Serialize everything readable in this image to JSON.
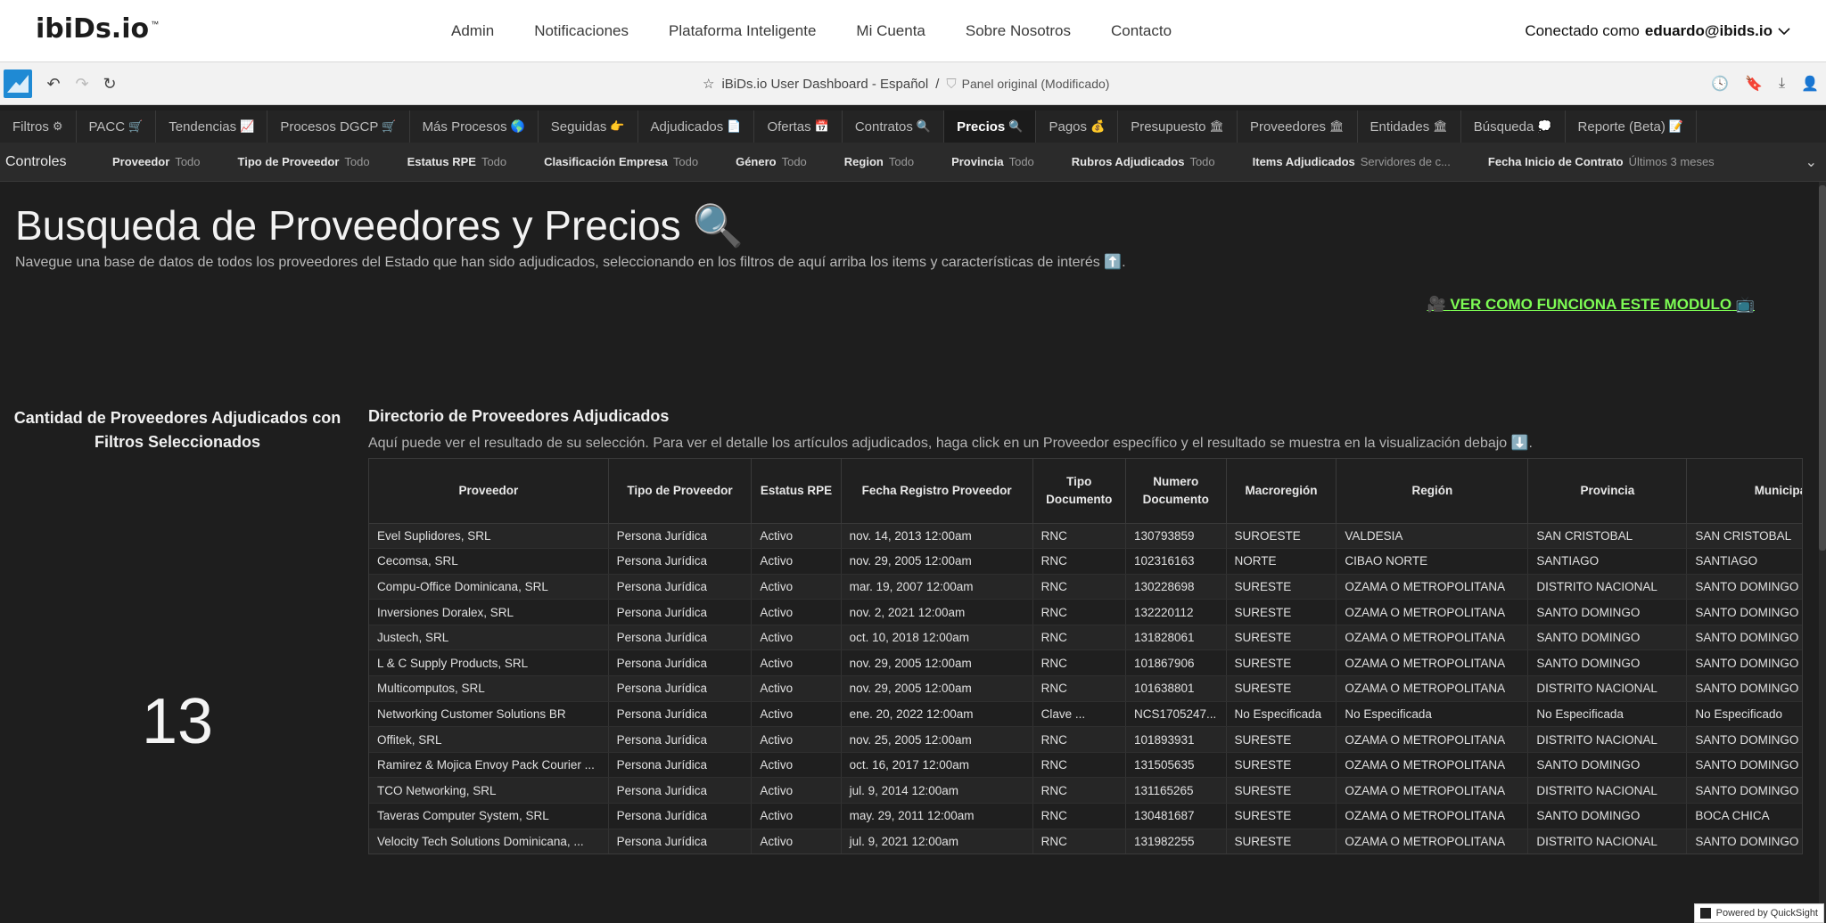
{
  "site": {
    "logo_text": "ibiDs.io",
    "nav": [
      "Admin",
      "Notificaciones",
      "Plataforma Inteligente",
      "Mi Cuenta",
      "Sobre Nosotros",
      "Contacto"
    ],
    "user_prefix": "Conectado como",
    "user_email": "eduardo@ibids.io"
  },
  "toolbar": {
    "dashboard_title": "iBiDs.io User Dashboard - Español",
    "separator": "/",
    "sheet_name": "Panel original (Modificado)"
  },
  "tabs": [
    {
      "label": "Filtros",
      "icon": "⚙"
    },
    {
      "label": "PACC",
      "icon": "🛒"
    },
    {
      "label": "Tendencias",
      "icon": "📈"
    },
    {
      "label": "Procesos DGCP",
      "icon": "🛒"
    },
    {
      "label": "Más Procesos",
      "icon": "🌎"
    },
    {
      "label": "Seguidas",
      "icon": "👉"
    },
    {
      "label": "Adjudicados",
      "icon": "📄"
    },
    {
      "label": "Ofertas",
      "icon": "📅"
    },
    {
      "label": "Contratos",
      "icon": "🔍"
    },
    {
      "label": "Precios",
      "icon": "🔍",
      "active": true
    },
    {
      "label": "Pagos",
      "icon": "💰"
    },
    {
      "label": "Presupuesto",
      "icon": "🏛"
    },
    {
      "label": "Proveedores",
      "icon": "🏛"
    },
    {
      "label": "Entidades",
      "icon": "🏛"
    },
    {
      "label": "Búsqueda",
      "icon": "💭"
    },
    {
      "label": "Reporte (Beta)",
      "icon": "📝"
    }
  ],
  "controls": {
    "label": "Controles",
    "items": [
      {
        "name": "Proveedor",
        "value": "Todo"
      },
      {
        "name": "Tipo de Proveedor",
        "value": "Todo"
      },
      {
        "name": "Estatus RPE",
        "value": "Todo"
      },
      {
        "name": "Clasificación Empresa",
        "value": "Todo"
      },
      {
        "name": "Género",
        "value": "Todo"
      },
      {
        "name": "Region",
        "value": "Todo"
      },
      {
        "name": "Provincia",
        "value": "Todo"
      },
      {
        "name": "Rubros Adjudicados",
        "value": "Todo"
      },
      {
        "name": "Items Adjudicados",
        "value": "Servidores de c..."
      },
      {
        "name": "Fecha Inicio de Contrato",
        "value": "Últimos 3 meses"
      }
    ]
  },
  "main": {
    "title": "Busqueda de Proveedores y Precios 🔍",
    "description": "Navegue una base de datos de todos los proveedores del Estado que han sido adjudicados, seleccionando en los filtros de aquí arriba los items y características de interés ⬆️.",
    "howto_link": "VER COMO FUNCIONA ESTE MODULO",
    "kpi": {
      "title": "Cantidad de Proveedores Adjudicados con Filtros Seleccionados",
      "value": "13"
    },
    "directory": {
      "title": "Directorio de Proveedores Adjudicados",
      "description": "Aquí puede ver el resultado de su selección. Para ver el detalle los artículos adjudicados, haga click en un Proveedor específico y el resultado se muestra en la visualización debajo ⬇️.",
      "columns": [
        "Proveedor",
        "Tipo de Proveedor",
        "Estatus RPE",
        "Fecha Registro Proveedor",
        "Tipo Documento",
        "Numero Documento",
        "Macroregión",
        "Región",
        "Provincia",
        "Municipalidad"
      ],
      "rows": [
        [
          "Evel Suplidores, SRL",
          "Persona Jurídica",
          "Activo",
          "nov. 14, 2013 12:00am",
          "RNC",
          "130793859",
          "SUROESTE",
          "VALDESIA",
          "SAN CRISTOBAL",
          "SAN CRISTOBAL"
        ],
        [
          "Cecomsa, SRL",
          "Persona Jurídica",
          "Activo",
          "nov. 29, 2005 12:00am",
          "RNC",
          "102316163",
          "NORTE",
          "CIBAO NORTE",
          "SANTIAGO",
          "SANTIAGO"
        ],
        [
          "Compu-Office Dominicana, SRL",
          "Persona Jurídica",
          "Activo",
          "mar. 19, 2007 12:00am",
          "RNC",
          "130228698",
          "SURESTE",
          "OZAMA O METROPOLITANA",
          "DISTRITO NACIONAL",
          "SANTO DOMINGO DE GUZMAN"
        ],
        [
          "Inversiones Doralex, SRL",
          "Persona Jurídica",
          "Activo",
          "nov. 2, 2021 12:00am",
          "RNC",
          "132220112",
          "SURESTE",
          "OZAMA O METROPOLITANA",
          "SANTO DOMINGO",
          "SANTO DOMINGO ESTE"
        ],
        [
          "Justech, SRL",
          "Persona Jurídica",
          "Activo",
          "oct. 10, 2018 12:00am",
          "RNC",
          "131828061",
          "SURESTE",
          "OZAMA O METROPOLITANA",
          "SANTO DOMINGO",
          "SANTO DOMINGO ESTE"
        ],
        [
          "L & C Supply Products, SRL",
          "Persona Jurídica",
          "Activo",
          "nov. 29, 2005 12:00am",
          "RNC",
          "101867906",
          "SURESTE",
          "OZAMA O METROPOLITANA",
          "SANTO DOMINGO",
          "SANTO DOMINGO ESTE"
        ],
        [
          "Multicomputos, SRL",
          "Persona Jurídica",
          "Activo",
          "nov. 29, 2005 12:00am",
          "RNC",
          "101638801",
          "SURESTE",
          "OZAMA O METROPOLITANA",
          "DISTRITO NACIONAL",
          "SANTO DOMINGO DE GUZMAN"
        ],
        [
          "Networking Customer Solutions BR",
          "Persona Jurídica",
          "Activo",
          "ene. 20, 2022 12:00am",
          "Clave ...",
          "NCS1705247...",
          "No Especificada",
          "No Especificada",
          "No Especificada",
          "No Especificado"
        ],
        [
          "Offitek, SRL",
          "Persona Jurídica",
          "Activo",
          "nov. 25, 2005 12:00am",
          "RNC",
          "101893931",
          "SURESTE",
          "OZAMA O METROPOLITANA",
          "DISTRITO NACIONAL",
          "SANTO DOMINGO DE GUZMAN"
        ],
        [
          "Ramirez & Mojica Envoy Pack Courier ...",
          "Persona Jurídica",
          "Activo",
          "oct. 16, 2017 12:00am",
          "RNC",
          "131505635",
          "SURESTE",
          "OZAMA O METROPOLITANA",
          "SANTO DOMINGO",
          "SANTO DOMINGO ESTE"
        ],
        [
          "TCO Networking, SRL",
          "Persona Jurídica",
          "Activo",
          "jul. 9, 2014 12:00am",
          "RNC",
          "131165265",
          "SURESTE",
          "OZAMA O METROPOLITANA",
          "DISTRITO NACIONAL",
          "SANTO DOMINGO DE GUZMAN"
        ],
        [
          "Taveras Computer System, SRL",
          "Persona Jurídica",
          "Activo",
          "may. 29, 2011 12:00am",
          "RNC",
          "130481687",
          "SURESTE",
          "OZAMA O METROPOLITANA",
          "SANTO DOMINGO",
          "BOCA CHICA"
        ],
        [
          "Velocity Tech Solutions Dominicana, ...",
          "Persona Jurídica",
          "Activo",
          "jul. 9, 2021 12:00am",
          "RNC",
          "131982255",
          "SURESTE",
          "OZAMA O METROPOLITANA",
          "DISTRITO NACIONAL",
          "SANTO DOMINGO DE GUZMAN"
        ]
      ]
    }
  },
  "footer": {
    "powered_by": "Powered by QuickSight"
  }
}
